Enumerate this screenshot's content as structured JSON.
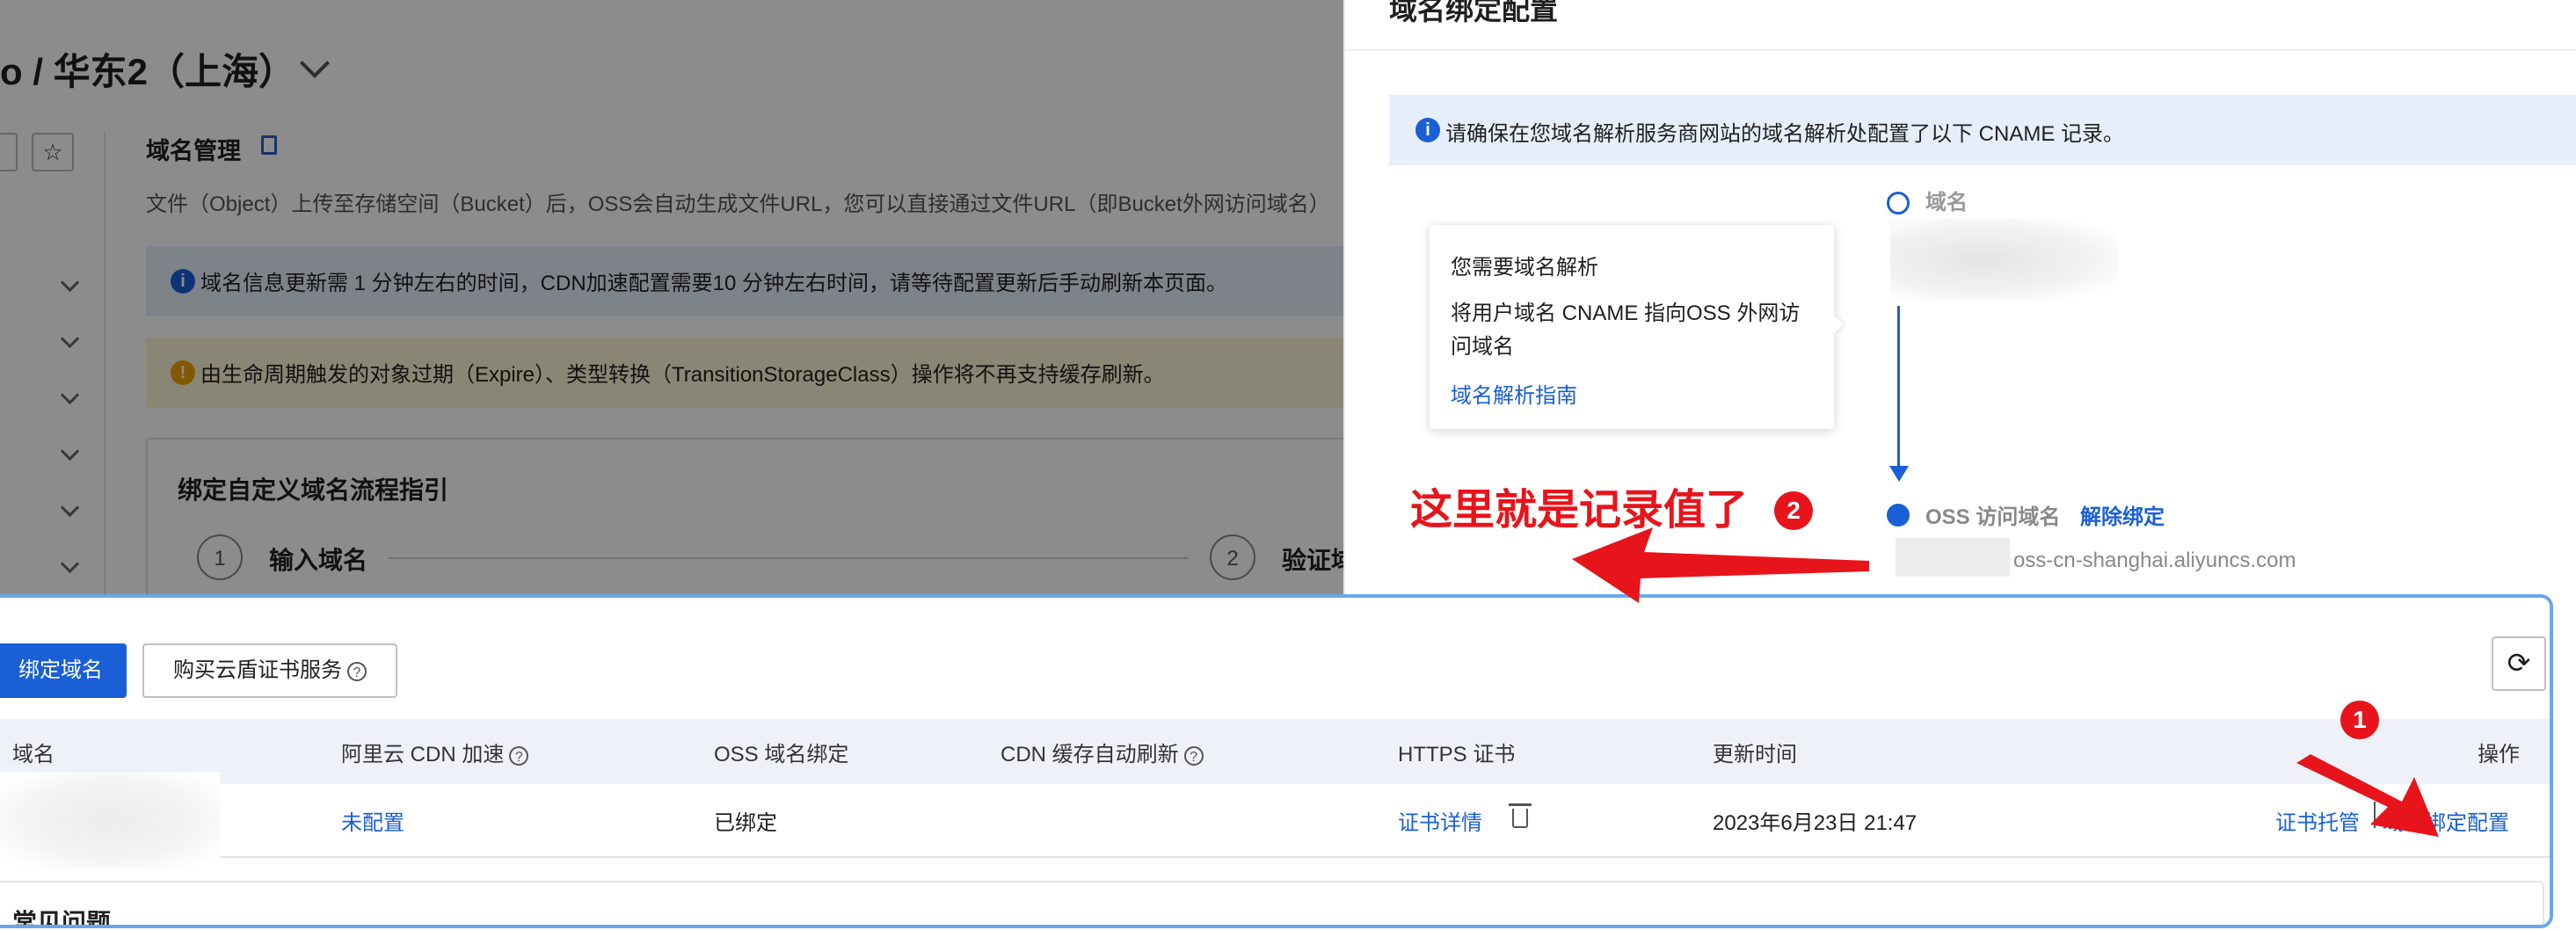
{
  "background_page": {
    "title": "o / 华东2（上海）",
    "section_title": "域名管理",
    "description": "文件（Object）上传至存储空间（Bucket）后，OSS会自动生成文件URL，您可以直接通过文件URL（即Bucket外网访问域名）",
    "info_notice": "域名信息更新需 1 分钟左右的时间，CDN加速配置需要10 分钟左右时间，请等待配置更新后手动刷新本页面。",
    "warning_notice": "由生命周期触发的对象过期（Expire）、类型转换（TransitionStorageClass）操作将不再支持缓存刷新。",
    "guide": {
      "title": "绑定自定义域名流程指引",
      "steps": [
        {
          "num": "1",
          "label": "输入域名"
        },
        {
          "num": "2",
          "label": "验证域"
        }
      ]
    }
  },
  "drawer": {
    "title": "域名绑定配置",
    "cname_notice": "请确保在您域名解析服务商网站的域名解析处配置了以下 CNAME 记录。",
    "popover": {
      "line1": "您需要域名解析",
      "line2": "将用户域名 CNAME 指向OSS 外网访问域名",
      "link": "域名解析指南"
    },
    "timeline": {
      "top_label": "域名",
      "bottom_label": "OSS 访问域名",
      "unbind_link": "解除绑定",
      "oss_domain_suffix": "oss-cn-shanghai.aliyuncs.com"
    }
  },
  "annotation": {
    "text": "这里就是记录值了",
    "badge1": "1",
    "badge2": "2",
    "color": "#e8141b"
  },
  "toolbar": {
    "bind_button": "绑定域名",
    "buy_button": "购买云盾证书服务",
    "help_glyph": "?",
    "refresh_glyph": "⟳"
  },
  "table": {
    "headers": {
      "domain": "域名",
      "cdn": "阿里云 CDN 加速",
      "oss_bind": "OSS 域名绑定",
      "cdn_refresh": "CDN 缓存自动刷新",
      "https": "HTTPS 证书",
      "updated": "更新时间",
      "actions": "操作"
    },
    "rows": [
      {
        "cdn": "未配置",
        "oss_bind": "已绑定",
        "https": "证书详情",
        "updated": "2023年6月23日 21:47",
        "action_cert": "证书托管",
        "action_bind": "域名绑定配置"
      }
    ]
  },
  "faq": {
    "title": "常见问题"
  },
  "colors": {
    "primary": "#1a5fd6",
    "info_bg": "#e6eefc",
    "warn_bg": "#fbf4d6",
    "panel_border": "#6aa6ee"
  }
}
